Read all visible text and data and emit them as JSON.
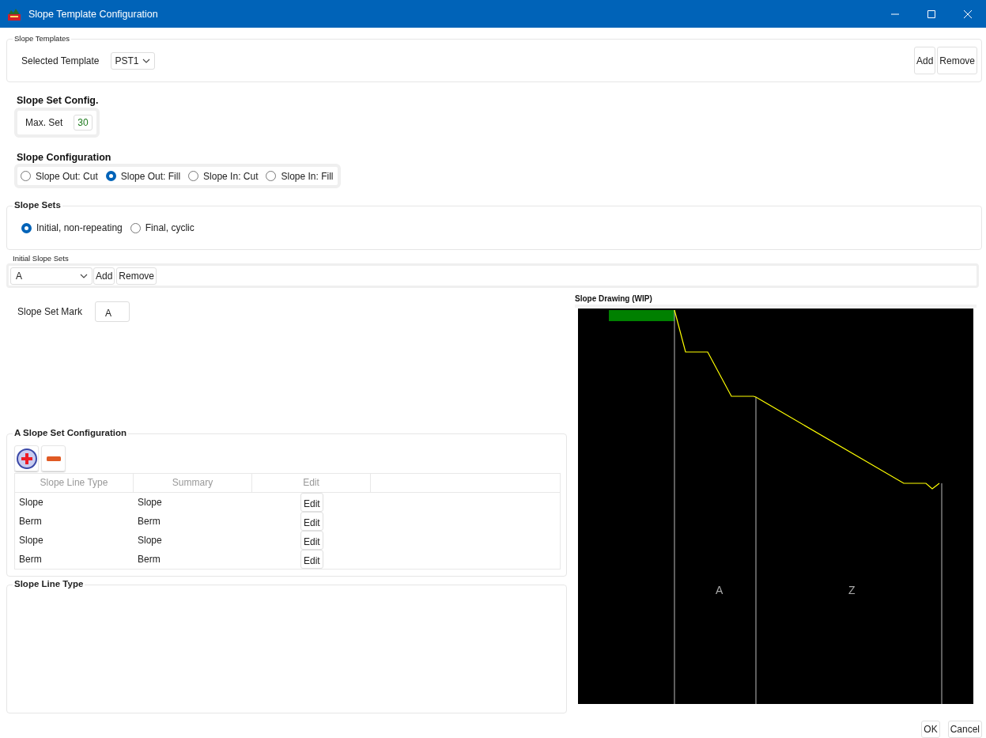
{
  "window": {
    "title": "Slope Template Configuration"
  },
  "slope_templates": {
    "legend": "Slope Templates",
    "label": "Selected Template",
    "template": "PST1",
    "buttons": [
      "Add",
      "Remove"
    ]
  },
  "slope_set_config": {
    "title": "Slope Set Config.",
    "label": "Max. Set",
    "value": "30"
  },
  "slope_configuration": {
    "title": "Slope Configuration",
    "options": [
      {
        "label": "Slope Out: Cut",
        "selected": false
      },
      {
        "label": "Slope Out: Fill",
        "selected": true
      },
      {
        "label": "Slope In: Cut",
        "selected": false
      },
      {
        "label": "Slope In: Fill",
        "selected": false
      }
    ]
  },
  "slope_sets": {
    "title": "Slope Sets",
    "options": [
      {
        "label": "Initial, non-repeating",
        "selected": true
      },
      {
        "label": "Final, cyclic",
        "selected": false
      }
    ]
  },
  "initial_slope_sets": {
    "legend": "Initial Slope Sets",
    "set": "A",
    "buttons": [
      "Add",
      "Remove"
    ]
  },
  "slope_set_mark": {
    "label": "Slope Set Mark",
    "value": "A"
  },
  "set_configuration": {
    "legend": "A Slope Set Configuration",
    "columns": [
      "Slope Line Type",
      "Summary",
      "Edit"
    ],
    "rows": [
      {
        "type": "Slope",
        "summary": "Slope",
        "edit": "Edit"
      },
      {
        "type": "Berm",
        "summary": "Berm",
        "edit": "Edit"
      },
      {
        "type": "Slope",
        "summary": "Slope",
        "edit": "Edit"
      },
      {
        "type": "Berm",
        "summary": "Berm",
        "edit": "Edit"
      }
    ]
  },
  "slope_line_type": {
    "legend": "Slope Line Type"
  },
  "drawing": {
    "title": "Slope Drawing (WIP)",
    "labels": [
      "A",
      "Z"
    ]
  },
  "footer": {
    "buttons": [
      "OK",
      "Cancel"
    ]
  }
}
